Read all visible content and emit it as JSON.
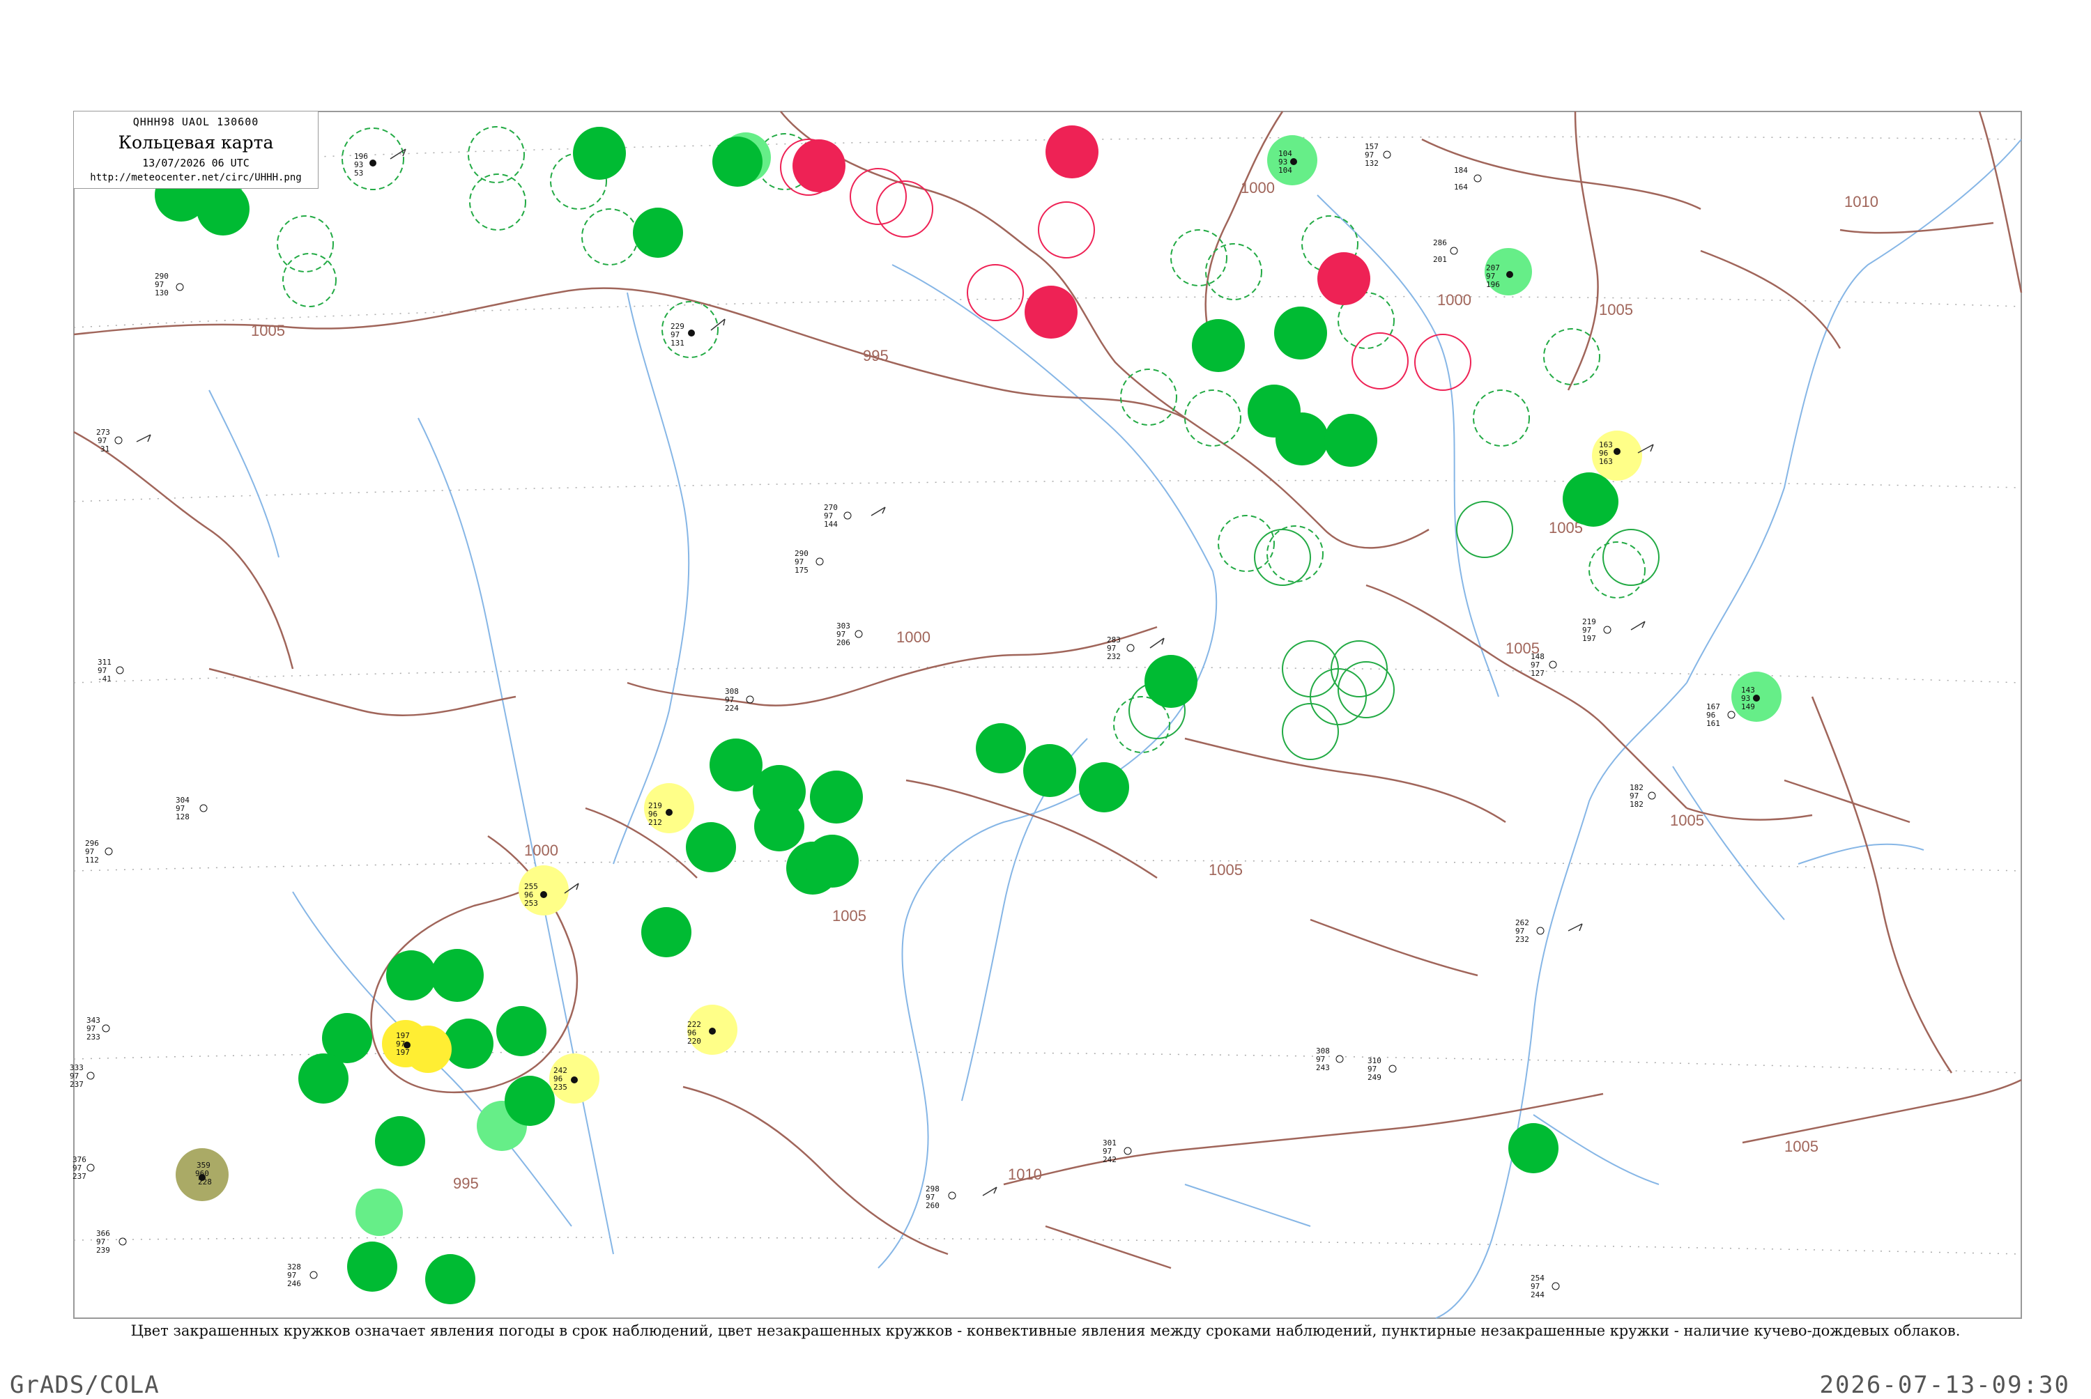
{
  "map": {
    "header_code": "QHHH98  UAOL  130600",
    "title": "Кольцевая карта",
    "valid_time": "13/07/2026 06 UTC",
    "url": "http://meteocenter.net/circ/UHHH.png"
  },
  "caption": "Цвет закрашенных кружков означает явления погоды в срок наблюдений, цвет незакрашенных кружков - конвективные явления между сроками наблюдений, пунктирные незакрашенные кружки - наличие кучево-дождевых облаков.",
  "footer": {
    "left": "GrADS/COLA",
    "right": "2026-07-13-09:30"
  },
  "colors": {
    "isobar": "#a0655a",
    "river": "#86b6e6",
    "frame": "#999999",
    "rain": "#00bb33",
    "light_rain": "#66ee88",
    "thunderstorm": "#ee2255",
    "fog_haze": "#ffff88",
    "mist": "#ffee33",
    "dust": "#aaaa66"
  },
  "isobar_labels": [
    {
      "value": "1000"
    },
    {
      "value": "1005"
    },
    {
      "value": "995"
    },
    {
      "value": "1010"
    },
    {
      "value": "1005"
    },
    {
      "value": "1000"
    },
    {
      "value": "1005"
    },
    {
      "value": "1010"
    },
    {
      "value": "1005"
    },
    {
      "value": "1005"
    },
    {
      "value": "1005"
    },
    {
      "value": "1000"
    },
    {
      "value": "1005"
    },
    {
      "value": "995"
    },
    {
      "value": "1000"
    },
    {
      "value": "1005"
    }
  ],
  "filled_circles": [
    {
      "weather": "rain",
      "color": "#00bb33"
    },
    {
      "weather": "rain",
      "color": "#00bb33"
    },
    {
      "weather": "rain",
      "color": "#00bb33"
    },
    {
      "weather": "thunderstorm",
      "color": "#ee2255"
    },
    {
      "weather": "thunderstorm",
      "color": "#ee2255"
    },
    {
      "weather": "thunderstorm",
      "color": "#ee2255"
    },
    {
      "weather": "light_rain",
      "color": "#66ee88"
    },
    {
      "weather": "fog_haze",
      "color": "#ffff88"
    },
    {
      "weather": "mist",
      "color": "#ffee33"
    },
    {
      "weather": "dust",
      "color": "#aaaa66"
    }
  ],
  "stations": [
    {
      "p": "196",
      "t": "93",
      "td": "53",
      "id": "",
      "name": ""
    },
    {
      "p": "229",
      "t": "97",
      "td": "131",
      "id": "",
      "name": ""
    },
    {
      "p": "163",
      "t": "96",
      "td": "163",
      "id": "",
      "name": ""
    },
    {
      "p": "255",
      "t": "96",
      "td": "253",
      "id": "",
      "name": ""
    },
    {
      "p": "222",
      "t": "96",
      "td": "220",
      "id": "",
      "name": ""
    },
    {
      "p": "219",
      "t": "96",
      "td": "212",
      "id": "",
      "name": ""
    },
    {
      "p": "359",
      "t": "960",
      "td": "228",
      "id": "",
      "name": ""
    },
    {
      "p": "197",
      "t": "97",
      "td": "197",
      "id": "",
      "name": ""
    },
    {
      "p": "242",
      "t": "96",
      "td": "235",
      "id": "",
      "name": ""
    },
    {
      "p": "143",
      "t": "93",
      "td": "149",
      "id": "",
      "name": ""
    },
    {
      "p": "104",
      "t": "93",
      "td": "104",
      "id": "",
      "name": ""
    },
    {
      "p": "207",
      "t": "97",
      "td": "196",
      "id": "",
      "name": ""
    },
    {
      "p": "290",
      "t": "97",
      "td": "130",
      "id": "",
      "name": ""
    },
    {
      "p": "273",
      "t": "97",
      "td": "31",
      "id": "",
      "name": ""
    },
    {
      "p": "311",
      "t": "97",
      "td": "-41",
      "id": "",
      "name": ""
    },
    {
      "p": "296",
      "t": "97",
      "td": "112",
      "id": "",
      "name": ""
    },
    {
      "p": "304",
      "t": "97",
      "td": "128",
      "id": "",
      "name": ""
    },
    {
      "p": "343",
      "t": "97",
      "td": "233",
      "id": "",
      "name": ""
    },
    {
      "p": "333",
      "t": "97",
      "td": "237",
      "id": "",
      "name": ""
    },
    {
      "p": "376",
      "t": "97",
      "td": "237",
      "id": "",
      "name": ""
    },
    {
      "p": "366",
      "t": "97",
      "td": "239",
      "id": "",
      "name": ""
    },
    {
      "p": "328",
      "t": "97",
      "td": "246",
      "id": "",
      "name": ""
    },
    {
      "p": "270",
      "t": "97",
      "td": "144",
      "id": "",
      "name": ""
    },
    {
      "p": "290",
      "t": "97",
      "td": "175",
      "id": "",
      "name": ""
    },
    {
      "p": "303",
      "t": "97",
      "td": "206",
      "id": "",
      "name": ""
    },
    {
      "p": "308",
      "t": "97",
      "td": "224",
      "id": "",
      "name": ""
    },
    {
      "p": "283",
      "t": "97",
      "td": "232",
      "id": "",
      "name": ""
    },
    {
      "p": "298",
      "t": "97",
      "td": "260",
      "id": "",
      "name": ""
    },
    {
      "p": "301",
      "t": "97",
      "td": "242",
      "id": "",
      "name": ""
    },
    {
      "p": "308",
      "t": "97",
      "td": "243",
      "id": "",
      "name": ""
    },
    {
      "p": "310",
      "t": "97",
      "td": "249",
      "id": "",
      "name": ""
    },
    {
      "p": "219",
      "t": "97",
      "td": "197",
      "id": "",
      "name": ""
    },
    {
      "p": "148",
      "t": "97",
      "td": "127",
      "id": "",
      "name": ""
    },
    {
      "p": "167",
      "t": "96",
      "td": "161",
      "id": "",
      "name": ""
    },
    {
      "p": "182",
      "t": "97",
      "td": "182",
      "id": "",
      "name": ""
    },
    {
      "p": "254",
      "t": "97",
      "td": "244",
      "id": "",
      "name": ""
    },
    {
      "p": "262",
      "t": "97",
      "td": "232",
      "id": "",
      "name": ""
    },
    {
      "p": "184",
      "t": "",
      "td": "164",
      "id": "",
      "name": ""
    },
    {
      "p": "157",
      "t": "97",
      "td": "132",
      "id": "",
      "name": ""
    },
    {
      "p": "286",
      "t": "",
      "td": "201",
      "id": "",
      "name": ""
    }
  ]
}
